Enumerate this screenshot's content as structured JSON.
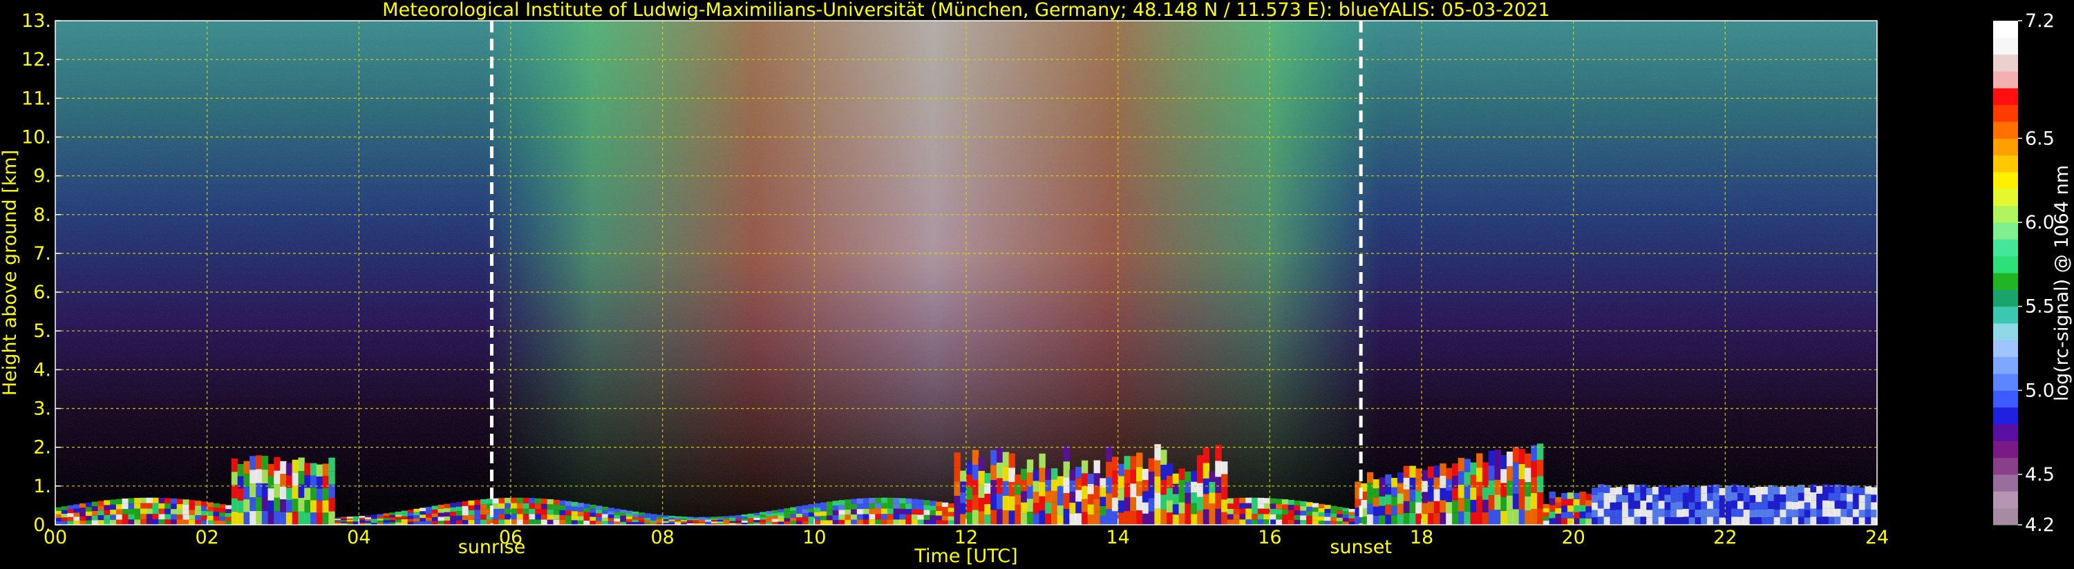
{
  "chart_data": {
    "type": "heatmap",
    "title": "Meteorological Institute of Ludwig-Maximilians-Universität (München, Germany; 48.148 N / 11.573 E):     blueYALIS: 05-03-2021",
    "xlabel": "Time [UTC]",
    "ylabel": "Height above ground [km]",
    "xlim": [
      0,
      24
    ],
    "ylim": [
      0,
      13
    ],
    "x_ticks": [
      "00",
      "02",
      "04",
      "06",
      "08",
      "10",
      "12",
      "14",
      "16",
      "18",
      "20",
      "22",
      "24"
    ],
    "y_ticks": [
      "0.",
      "1.",
      "2.",
      "3.",
      "4.",
      "5.",
      "6.",
      "7.",
      "8.",
      "9.",
      "10.",
      "11.",
      "12.",
      "13."
    ],
    "grid": true,
    "annotations": [
      {
        "label": "sunrise",
        "x": 5.75
      },
      {
        "label": "sunset",
        "x": 17.2
      }
    ],
    "colorbar": {
      "label": "log(rc-signal) @ 1064 nm",
      "range": [
        4.2,
        7.2
      ],
      "ticks": [
        "4.2",
        "4.5",
        "5.0",
        "5.5",
        "6.0",
        "6.5",
        "7.2"
      ],
      "tick_values": [
        4.2,
        4.5,
        5.0,
        5.5,
        6.0,
        6.5,
        7.2
      ],
      "colors": [
        "#a58ca3",
        "#b695b3",
        "#9a6e9c",
        "#8a3f8a",
        "#7a1a86",
        "#5a0fa0",
        "#2020e0",
        "#3d5cff",
        "#5b86ff",
        "#7ea8ff",
        "#9fc4ff",
        "#8fd9e6",
        "#3cc8b0",
        "#1aa36a",
        "#22b422",
        "#2ee07a",
        "#44e69a",
        "#7fef8f",
        "#b0f560",
        "#e4f830",
        "#fff000",
        "#ffc800",
        "#ff9f00",
        "#ff7000",
        "#ff3c00",
        "#ff1010",
        "#f2b0b0",
        "#ecd0d0",
        "#f7f7f7",
        "#ffffff"
      ]
    },
    "colors": {
      "text": "#ffff00",
      "grid": "#d8d800",
      "markers": "#ffffff",
      "background": "#000000"
    }
  }
}
